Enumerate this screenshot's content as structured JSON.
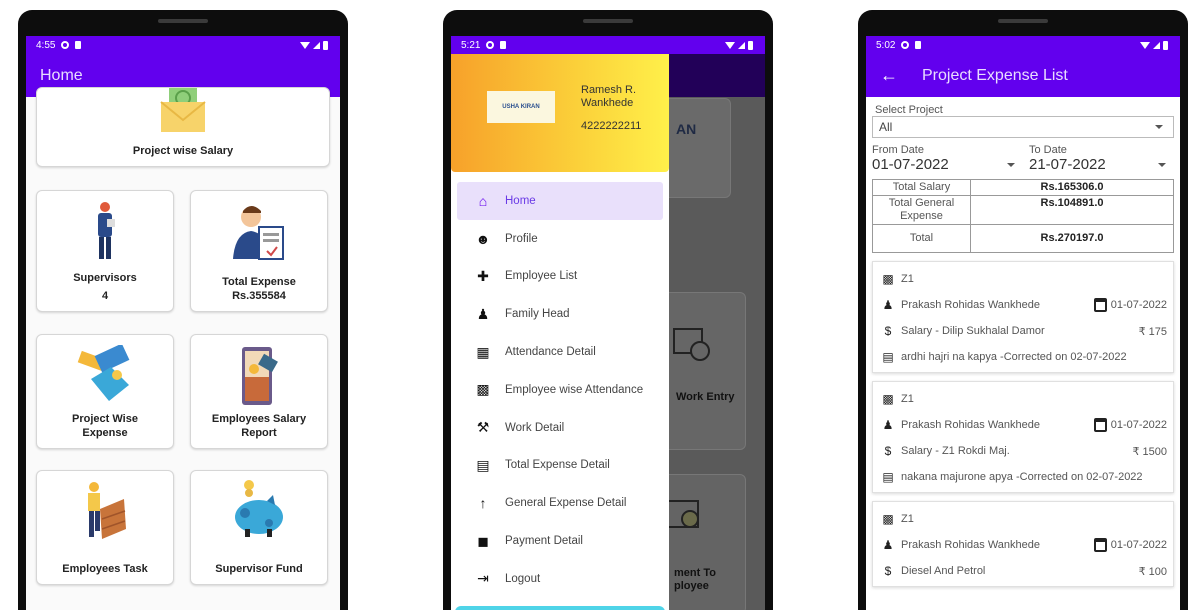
{
  "phone1": {
    "status": {
      "time": "4:55"
    },
    "appbar": {
      "title": "Home"
    },
    "cards": [
      {
        "label": "Project wise Salary",
        "icon": "salary-envelope-icon"
      },
      {
        "label": "Supervisors",
        "value": "4",
        "icon": "supervisor-icon"
      },
      {
        "label": "Total Expense",
        "value": "Rs.355584",
        "icon": "expense-report-icon"
      },
      {
        "label": "Project Wise",
        "label2": "Expense",
        "icon": "wallet-card-icon"
      },
      {
        "label": "Employees Salary",
        "label2": "Report",
        "icon": "salary-report-icon"
      },
      {
        "label": "Employees Task",
        "icon": "worker-task-icon"
      },
      {
        "label": "Supervisor Fund",
        "icon": "piggy-bank-icon"
      }
    ]
  },
  "phone2": {
    "status": {
      "time": "5:21"
    },
    "drawer": {
      "logo_text": "USHA KIRAN",
      "user_name": "Ramesh R. Wankhede",
      "user_phone": "4222222211",
      "items": [
        {
          "label": "Home",
          "icon": "home-icon",
          "active": true
        },
        {
          "label": "Profile",
          "icon": "profile-icon"
        },
        {
          "label": "Employee List",
          "icon": "add-person-icon"
        },
        {
          "label": "Family Head",
          "icon": "group-icon"
        },
        {
          "label": "Attendance Detail",
          "icon": "calendar-icon"
        },
        {
          "label": "Employee wise Attendance",
          "icon": "badge-icon"
        },
        {
          "label": "Work Detail",
          "icon": "tools-icon"
        },
        {
          "label": "Total Expense Detail",
          "icon": "card-icon"
        },
        {
          "label": "General Expense Detail",
          "icon": "arrow-up-icon"
        },
        {
          "label": "Payment Detail",
          "icon": "payments-icon"
        },
        {
          "label": "Logout",
          "icon": "logout-icon"
        }
      ]
    },
    "background": {
      "logo_fragment": "AN",
      "card1": "Work Entry",
      "card2a": "ment To",
      "card2b": "ployee"
    }
  },
  "phone3": {
    "status": {
      "time": "5:02"
    },
    "appbar": {
      "title": "Project Expense List"
    },
    "select_project": {
      "label": "Select Project",
      "value": "All"
    },
    "from_date": {
      "label": "From Date",
      "value": "01-07-2022"
    },
    "to_date": {
      "label": "To Date",
      "value": "21-07-2022"
    },
    "summary": [
      {
        "key": "Total Salary",
        "value": "Rs.165306.0"
      },
      {
        "key": "Total General Expense",
        "value": "Rs.104891.0"
      },
      {
        "key": "Total",
        "value": "Rs.270197.0"
      }
    ],
    "entries": [
      {
        "project": "Z1",
        "person": "Prakash Rohidas Wankhede",
        "date": "01-07-2022",
        "category": "Salary - Dilip Sukhalal Damor",
        "amount": "₹ 175",
        "note": "ardhi hajri na kapya -Corrected on 02-07-2022"
      },
      {
        "project": "Z1",
        "person": "Prakash Rohidas Wankhede",
        "date": "01-07-2022",
        "category": "Salary - Z1 Rokdi Maj.",
        "amount": "₹ 1500",
        "note": "nakana majurone apya -Corrected on 02-07-2022"
      },
      {
        "project": "Z1",
        "person": "Prakash Rohidas Wankhede",
        "date": "01-07-2022",
        "category": "Diesel And Petrol",
        "amount": "₹ 100",
        "note": ""
      }
    ]
  },
  "colors": {
    "primary": "#6200ee",
    "drawer_active_bg": "#e9e0fb",
    "header_gradient_start": "#f7a12a",
    "header_gradient_end": "#fff04a"
  }
}
